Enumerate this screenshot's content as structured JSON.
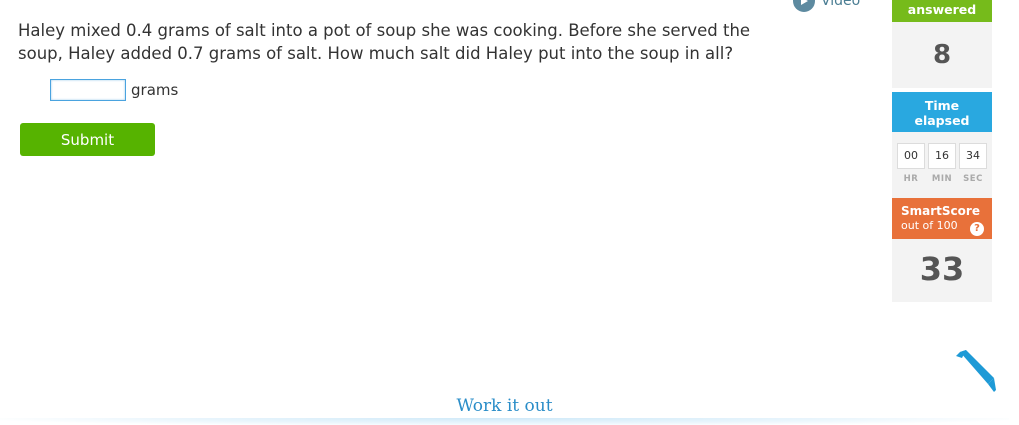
{
  "question": {
    "text": "Haley mixed 0.4 grams of salt into a pot of soup she was cooking. Before she served the soup, Haley added 0.7 grams of salt. How much salt did Haley put into the soup in all?"
  },
  "answer": {
    "value": "",
    "unit": "grams"
  },
  "submit": {
    "label": "Submit"
  },
  "video": {
    "label": "Video"
  },
  "stats": {
    "answered_label": "answered",
    "answered_count": "8",
    "time_label_line1": "Time",
    "time_label_line2": "elapsed",
    "time_hr": "00",
    "time_min": "16",
    "time_sec": "34",
    "hr_label": "HR",
    "min_label": "MIN",
    "sec_label": "SEC",
    "smartscore_title": "SmartScore",
    "smartscore_sub": "out of 100",
    "help_glyph": "?",
    "smartscore_value": "33"
  },
  "work_it_out": {
    "label": "Work it out"
  },
  "colors": {
    "submit_green": "#56b300",
    "answered_green": "#76bb1b",
    "time_blue": "#29a8e0",
    "smartscore_orange": "#e8713a",
    "link_blue": "#2a8dc8"
  },
  "icons": {
    "video": "play-circle-icon",
    "help": "question-circle-icon",
    "edit": "pencil-icon"
  }
}
